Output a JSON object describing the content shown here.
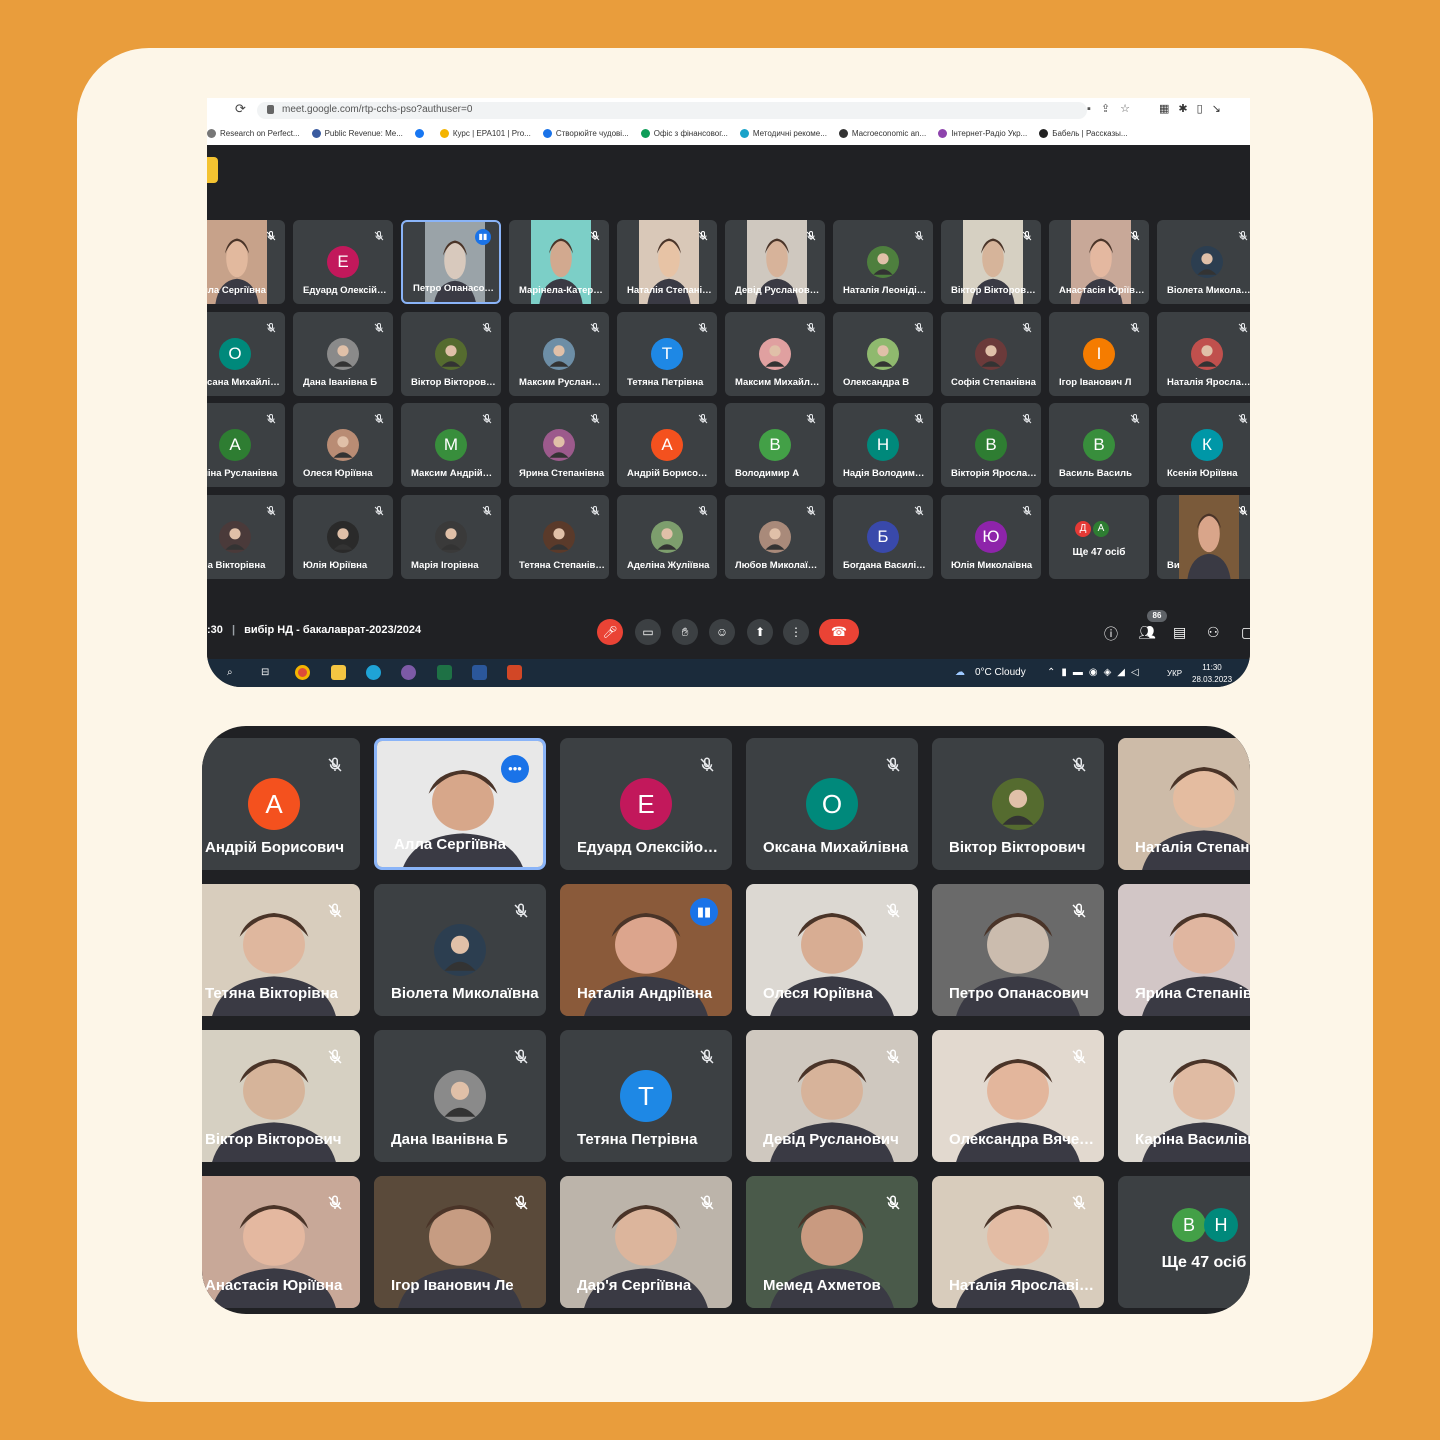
{
  "browser": {
    "url": "meet.google.com/rtp-cchs-pso?authuser=0",
    "bookmarks": [
      {
        "label": "Research on Perfect...",
        "color": "#777777"
      },
      {
        "label": "Public Revenue: Me...",
        "color": "#3a5ba0"
      },
      {
        "label": "",
        "color": "#1877f2"
      },
      {
        "label": "Курс | EPA101 | Pro...",
        "color": "#f4b400"
      },
      {
        "label": "Створюйте чудові...",
        "color": "#1a73e8"
      },
      {
        "label": "Офіс з фінансовог...",
        "color": "#0f9d58"
      },
      {
        "label": "Методичні рекоме...",
        "color": "#1aa3c9"
      },
      {
        "label": "Macroeconomic an...",
        "color": "#333333"
      },
      {
        "label": "Інтернет-Радіо Укр...",
        "color": "#8e44ad"
      },
      {
        "label": "Бабель | Рассказы...",
        "color": "#222222"
      }
    ]
  },
  "meet_top": {
    "meeting_time": ":30",
    "meeting_title": "вибір НД - бакалаврат-2023/2024",
    "participant_count": "86",
    "tiles": [
      {
        "name": "Алла Сергіївна",
        "video": true,
        "bg": "#c7a28a",
        "skin": "#e2b99e"
      },
      {
        "name": "Едуард Олексійович",
        "initial": "Е",
        "color": "#c2185b"
      },
      {
        "name": "Петро Опанасович",
        "video": true,
        "bg": "#9aa3a8",
        "skin": "#d8c9bd",
        "active": true
      },
      {
        "name": "Марінела-Катерина",
        "video": true,
        "bg": "#7ccfc7",
        "skin": "#d2a98f"
      },
      {
        "name": "Наталія Степанівна",
        "video": true,
        "bg": "#d9c8b8",
        "skin": "#e7c3a5"
      },
      {
        "name": "Девід Русланович",
        "video": true,
        "bg": "#cfc8bf",
        "skin": "#d7b39a"
      },
      {
        "name": "Наталія Леонідівна",
        "avatar": "#4e7f3e"
      },
      {
        "name": "Віктор Вікторович",
        "video": true,
        "bg": "#d6d0c2",
        "skin": "#d6b49a"
      },
      {
        "name": "Анастасія Юріївна",
        "video": true,
        "bg": "#c8a898",
        "skin": "#e4b8a0"
      },
      {
        "name": "Віолета Миколаївна",
        "avatar": "#2c3e50"
      },
      {
        "name": "Оксана Михайлівна",
        "initial": "О",
        "color": "#00897b"
      },
      {
        "name": "Дана Іванівна Б",
        "avatar": "#8a8a8a"
      },
      {
        "name": "Віктор Вікторович",
        "avatar": "#556b2f"
      },
      {
        "name": "Максим Русланович",
        "avatar": "#6d8ea6"
      },
      {
        "name": "Тетяна Петрівна",
        "initial": "Т",
        "color": "#1e88e5"
      },
      {
        "name": "Максим Михайлович",
        "avatar": "#e0a0a0"
      },
      {
        "name": "Олександра В",
        "avatar": "#8fb96e"
      },
      {
        "name": "Софія Степанівна",
        "avatar": "#6b3a3a"
      },
      {
        "name": "Ігор Іванович Л",
        "initial": "І",
        "color": "#f57c00"
      },
      {
        "name": "Наталія Ярославівна",
        "avatar": "#c0504d"
      },
      {
        "name": "Аліна Русланівна",
        "initial": "А",
        "color": "#2e7d32"
      },
      {
        "name": "Олеся Юріївна",
        "avatar": "#b98c74"
      },
      {
        "name": "Максим Андрійович",
        "initial": "М",
        "color": "#388e3c"
      },
      {
        "name": "Ярина Степанівна",
        "avatar": "#9c5a8c"
      },
      {
        "name": "Андрій Борисович",
        "initial": "А",
        "color": "#f4511e"
      },
      {
        "name": "Володимир А",
        "initial": "В",
        "color": "#43a047"
      },
      {
        "name": "Надія Володимирівна",
        "initial": "Н",
        "color": "#00897b"
      },
      {
        "name": "Вікторія Ярославівна",
        "initial": "В",
        "color": "#2e7d32"
      },
      {
        "name": "Василь Василь",
        "initial": "В",
        "color": "#388e3c"
      },
      {
        "name": "Ксенія Юріївна",
        "initial": "К",
        "color": "#0097a7"
      },
      {
        "name": "Яна Вікторівна",
        "avatar": "#4a3a3a"
      },
      {
        "name": "Юлія Юріївна",
        "avatar": "#2a2a2a"
      },
      {
        "name": "Марія Ігорівна",
        "avatar": "#3a3a3a"
      },
      {
        "name": "Тетяна Степанівна",
        "avatar": "#5a3a2a"
      },
      {
        "name": "Аделіна Жуліївна",
        "avatar": "#7d9e6d"
      },
      {
        "name": "Любов Миколаївна",
        "avatar": "#a98a7a"
      },
      {
        "name": "Богдана Василівна",
        "initial": "Б",
        "color": "#3949ab"
      },
      {
        "name": "Юлія Миколаївна",
        "initial": "Ю",
        "color": "#8e24aa"
      },
      {
        "more": "Ще 47 осіб",
        "initials": [
          "Д",
          "А"
        ],
        "colors": [
          "#e53935",
          "#2e7d32"
        ]
      },
      {
        "name": "Ви",
        "video": true,
        "bg": "#7a5a3a",
        "skin": "#d9a58a"
      }
    ]
  },
  "taskbar": {
    "weather": "0°C Cloudy",
    "lang": "УКР",
    "time": "11:30",
    "date": "28.03.2023"
  },
  "meet_bottom": {
    "tiles": [
      {
        "name": "Андрій Борисович",
        "initial": "А",
        "color": "#f4511e"
      },
      {
        "name": "Алла Сергіївна",
        "video": true,
        "bg": "#e8e8e8",
        "skin": "#d7a78a",
        "active": true,
        "more_badge": true
      },
      {
        "name": "Едуард Олексійович",
        "initial": "Е",
        "color": "#c2185b"
      },
      {
        "name": "Оксана Михайлівна",
        "initial": "О",
        "color": "#00897b"
      },
      {
        "name": "Віктор Вікторович",
        "avatar": "#556b2f"
      },
      {
        "name": "Наталія Степанівна",
        "video": true,
        "bg": "#cdbba8",
        "skin": "#e4bca0"
      },
      {
        "name": "Тетяна Вікторівна",
        "video": true,
        "bg": "#d8cdbd",
        "skin": "#dfb79e"
      },
      {
        "name": "Віолета Миколаївна",
        "avatar": "#2c3e50"
      },
      {
        "name": "Наталія Андріївна",
        "video": true,
        "bg": "#8a5a3a",
        "skin": "#dca58d",
        "speaking": true
      },
      {
        "name": "Олеся Юріївна",
        "video": true,
        "bg": "#dcd8d2",
        "skin": "#d8ad93"
      },
      {
        "name": "Петро Опанасович",
        "video": true,
        "bg": "#6a6a6a",
        "skin": "#cbbcae"
      },
      {
        "name": "Ярина Степанівна",
        "video": true,
        "bg": "#d2c6c6",
        "skin": "#e0b6a0"
      },
      {
        "name": "Віктор Вікторович",
        "video": true,
        "bg": "#d6d0c2",
        "skin": "#d6b49a"
      },
      {
        "name": "Дана Іванівна Б",
        "avatar": "#8a8a8a"
      },
      {
        "name": "Тетяна Петрівна",
        "initial": "Т",
        "color": "#1e88e5"
      },
      {
        "name": "Девід Русланович",
        "video": true,
        "bg": "#cfc8bf",
        "skin": "#d7b39a"
      },
      {
        "name": "Олександра Вячеславівна",
        "video": true,
        "bg": "#e2d9cf",
        "skin": "#e3b69c"
      },
      {
        "name": "Каріна Василівна",
        "video": true,
        "bg": "#ddd8d0",
        "skin": "#e0bba3"
      },
      {
        "name": "Анастасія Юріївна",
        "video": true,
        "bg": "#c8a898",
        "skin": "#e4b8a0"
      },
      {
        "name": "Ігор Іванович Ле",
        "video": true,
        "bg": "#5a4a3a",
        "skin": "#c69c82"
      },
      {
        "name": "Дар'я Сергіївна",
        "video": true,
        "bg": "#bcb4aa",
        "skin": "#dcb59c"
      },
      {
        "name": "Мемед Ахметов",
        "video": true,
        "bg": "#4a5a4a",
        "skin": "#c99a80"
      },
      {
        "name": "Наталія Ярославівна",
        "video": true,
        "bg": "#d8ccbc",
        "skin": "#e3bca4"
      },
      {
        "more": "Ще 47 осіб",
        "initials": [
          "В",
          "Н"
        ],
        "colors": [
          "#43a047",
          "#00897b"
        ]
      }
    ]
  }
}
